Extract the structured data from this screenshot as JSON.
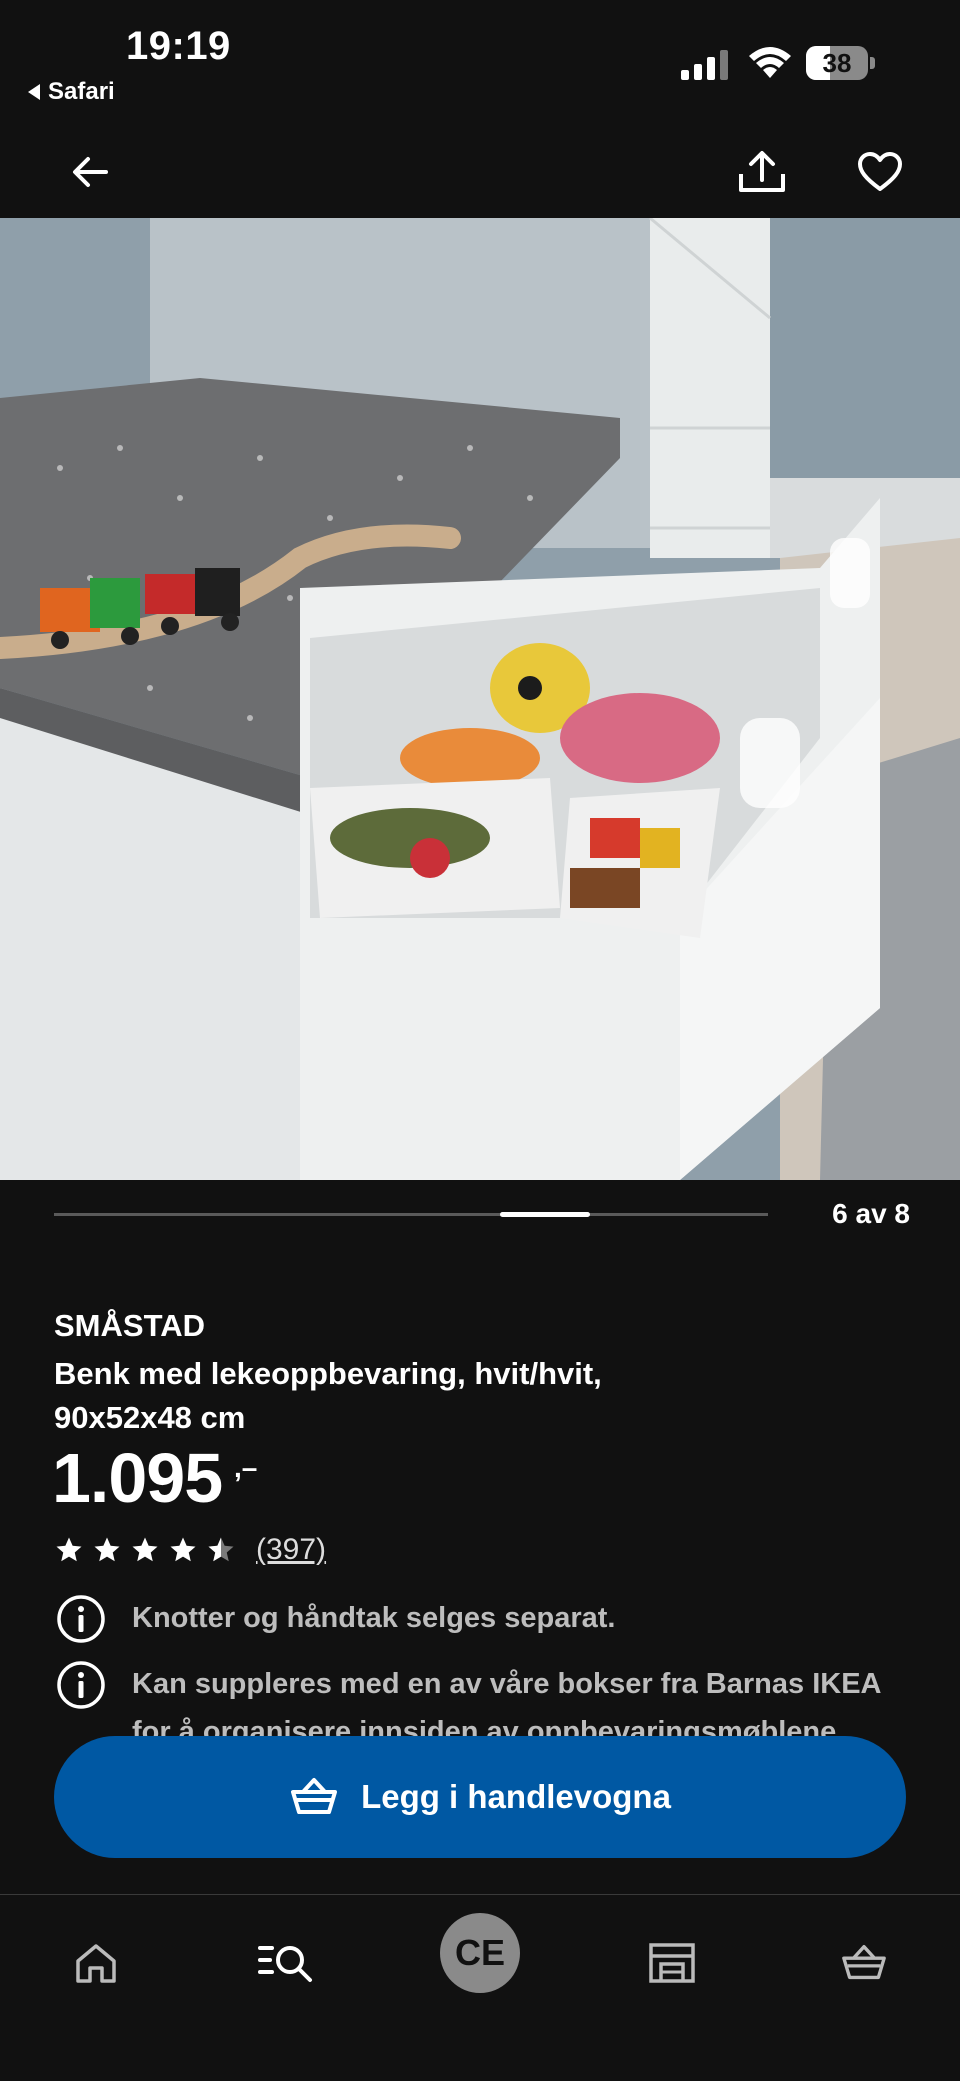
{
  "status_bar": {
    "time": "19:19",
    "back_app": "Safari",
    "battery": "38",
    "battery_level": 0.38
  },
  "header": {
    "back_icon": "arrow-left-icon",
    "share_icon": "share-icon",
    "favorite_icon": "heart-icon"
  },
  "gallery": {
    "counter": "6 av 8",
    "current": 6,
    "total": 8
  },
  "product": {
    "name": "SMÅSTAD",
    "description": "Benk med lekeoppbevaring, hvit/hvit, 90x52x48 cm",
    "price": "1.095",
    "price_suffix": ",–",
    "rating": 4.5,
    "review_count": "(397)"
  },
  "notes": [
    {
      "icon": "info-icon",
      "text": "Knotter og håndtak selges separat."
    },
    {
      "icon": "info-icon",
      "text": "Kan suppleres med en av våre bokser fra Barnas IKEA for å organisere innsiden av oppbevaringsmøblene."
    }
  ],
  "cta": {
    "label": "Legg i handlevogna",
    "icon": "basket-icon",
    "color": "#0058a3"
  },
  "bottom_nav": {
    "items": [
      {
        "icon": "home-icon"
      },
      {
        "icon": "search-list-icon"
      },
      {
        "label": "CE"
      },
      {
        "icon": "store-icon"
      },
      {
        "icon": "cart-icon"
      }
    ]
  }
}
